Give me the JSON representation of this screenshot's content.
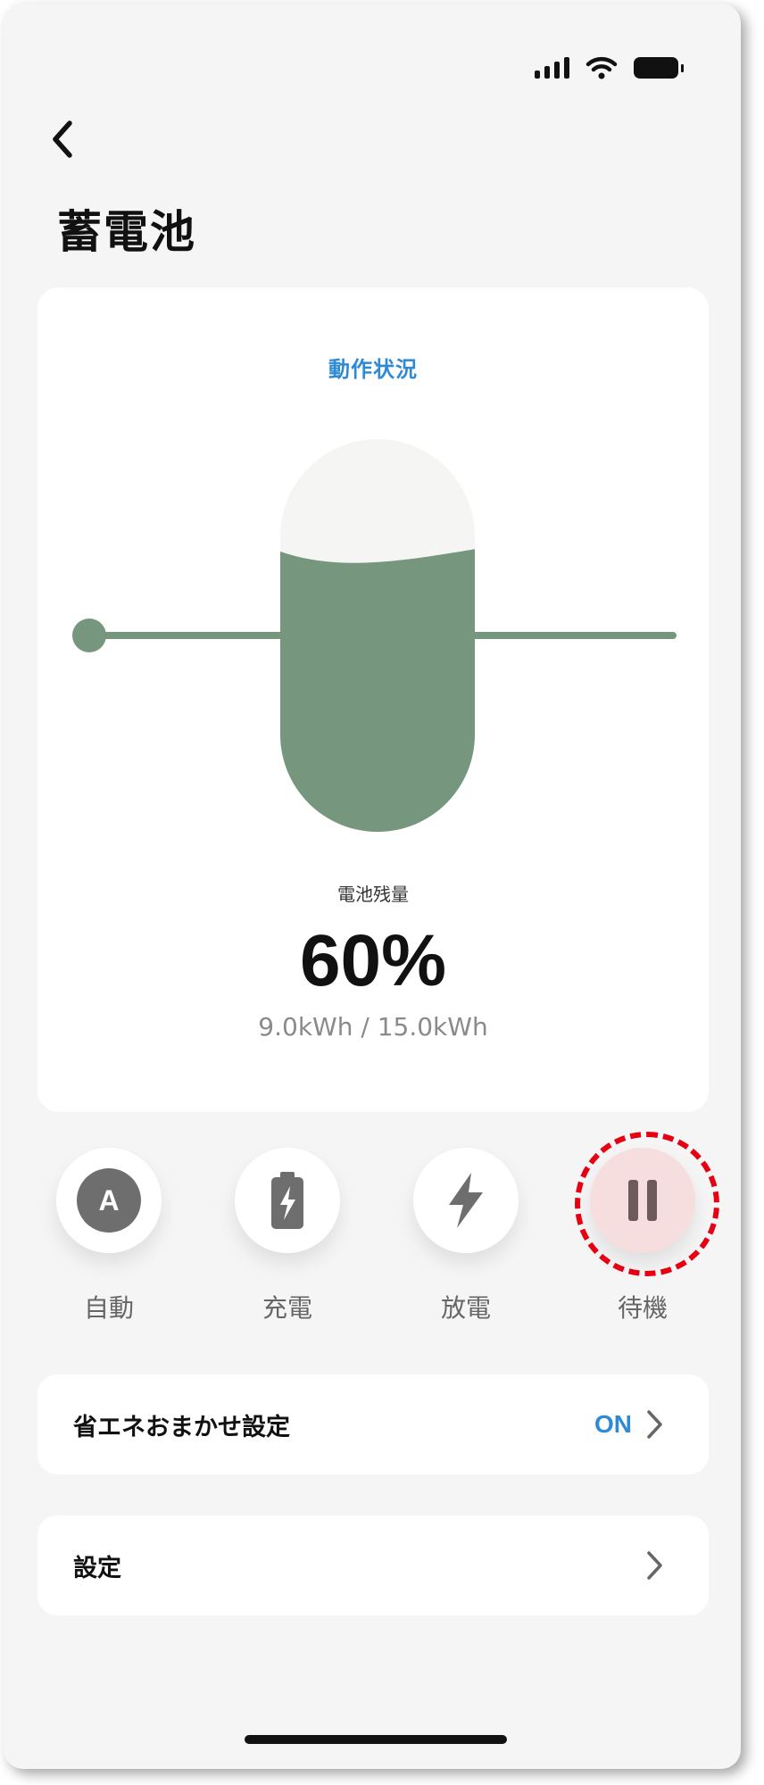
{
  "header": {
    "title": "蓄電池",
    "back_icon": "chevron-left-icon"
  },
  "status_card": {
    "title": "動作状況",
    "level_label": "電池残量",
    "percent_text": "60%",
    "charge_level": 0.6,
    "capacity_text": "9.0kWh / 15.0kWh",
    "colors": {
      "accent": "#2f8ad6",
      "fill": "#76967e",
      "empty": "#f5f5f3"
    }
  },
  "modes": [
    {
      "label": "自動",
      "icon": "auto-a-icon",
      "active": false
    },
    {
      "label": "充電",
      "icon": "battery-charge-icon",
      "active": false
    },
    {
      "label": "放電",
      "icon": "lightning-icon",
      "active": false
    },
    {
      "label": "待機",
      "icon": "pause-icon",
      "active": true
    }
  ],
  "rows": {
    "energy_saving": {
      "label": "省エネおまかせ設定",
      "value": "ON"
    },
    "settings": {
      "label": "設定"
    }
  },
  "colors": {
    "highlight": "#e60012",
    "active_mode": "#f6dede"
  }
}
